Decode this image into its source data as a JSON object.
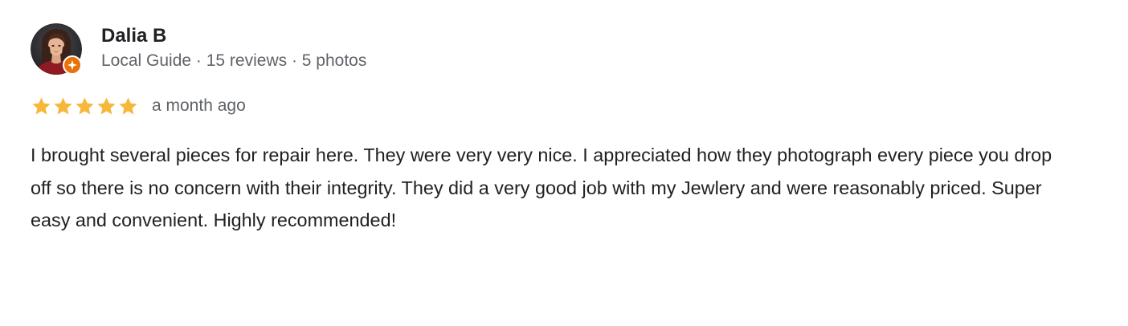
{
  "review": {
    "reviewer_name": "Dalia B",
    "reviewer_meta": "Local Guide · 15 reviews · 5 photos",
    "rating": 5,
    "rating_max": 5,
    "date": "a month ago",
    "text": "I brought several pieces for repair here. They were very very nice. I appreciated how they photograph every piece you drop off so there is no concern with their integrity. They did a very good job with my Jewlery and were reasonably priced. Super easy and convenient. Highly recommended!"
  },
  "icons": {
    "avatar": "profile-photo",
    "badge": "local-guide-badge-icon",
    "star": "star-icon"
  },
  "colors": {
    "star": "#f6b83a",
    "badge": "#e8710a",
    "name": "#202124",
    "meta": "#5f6368"
  }
}
